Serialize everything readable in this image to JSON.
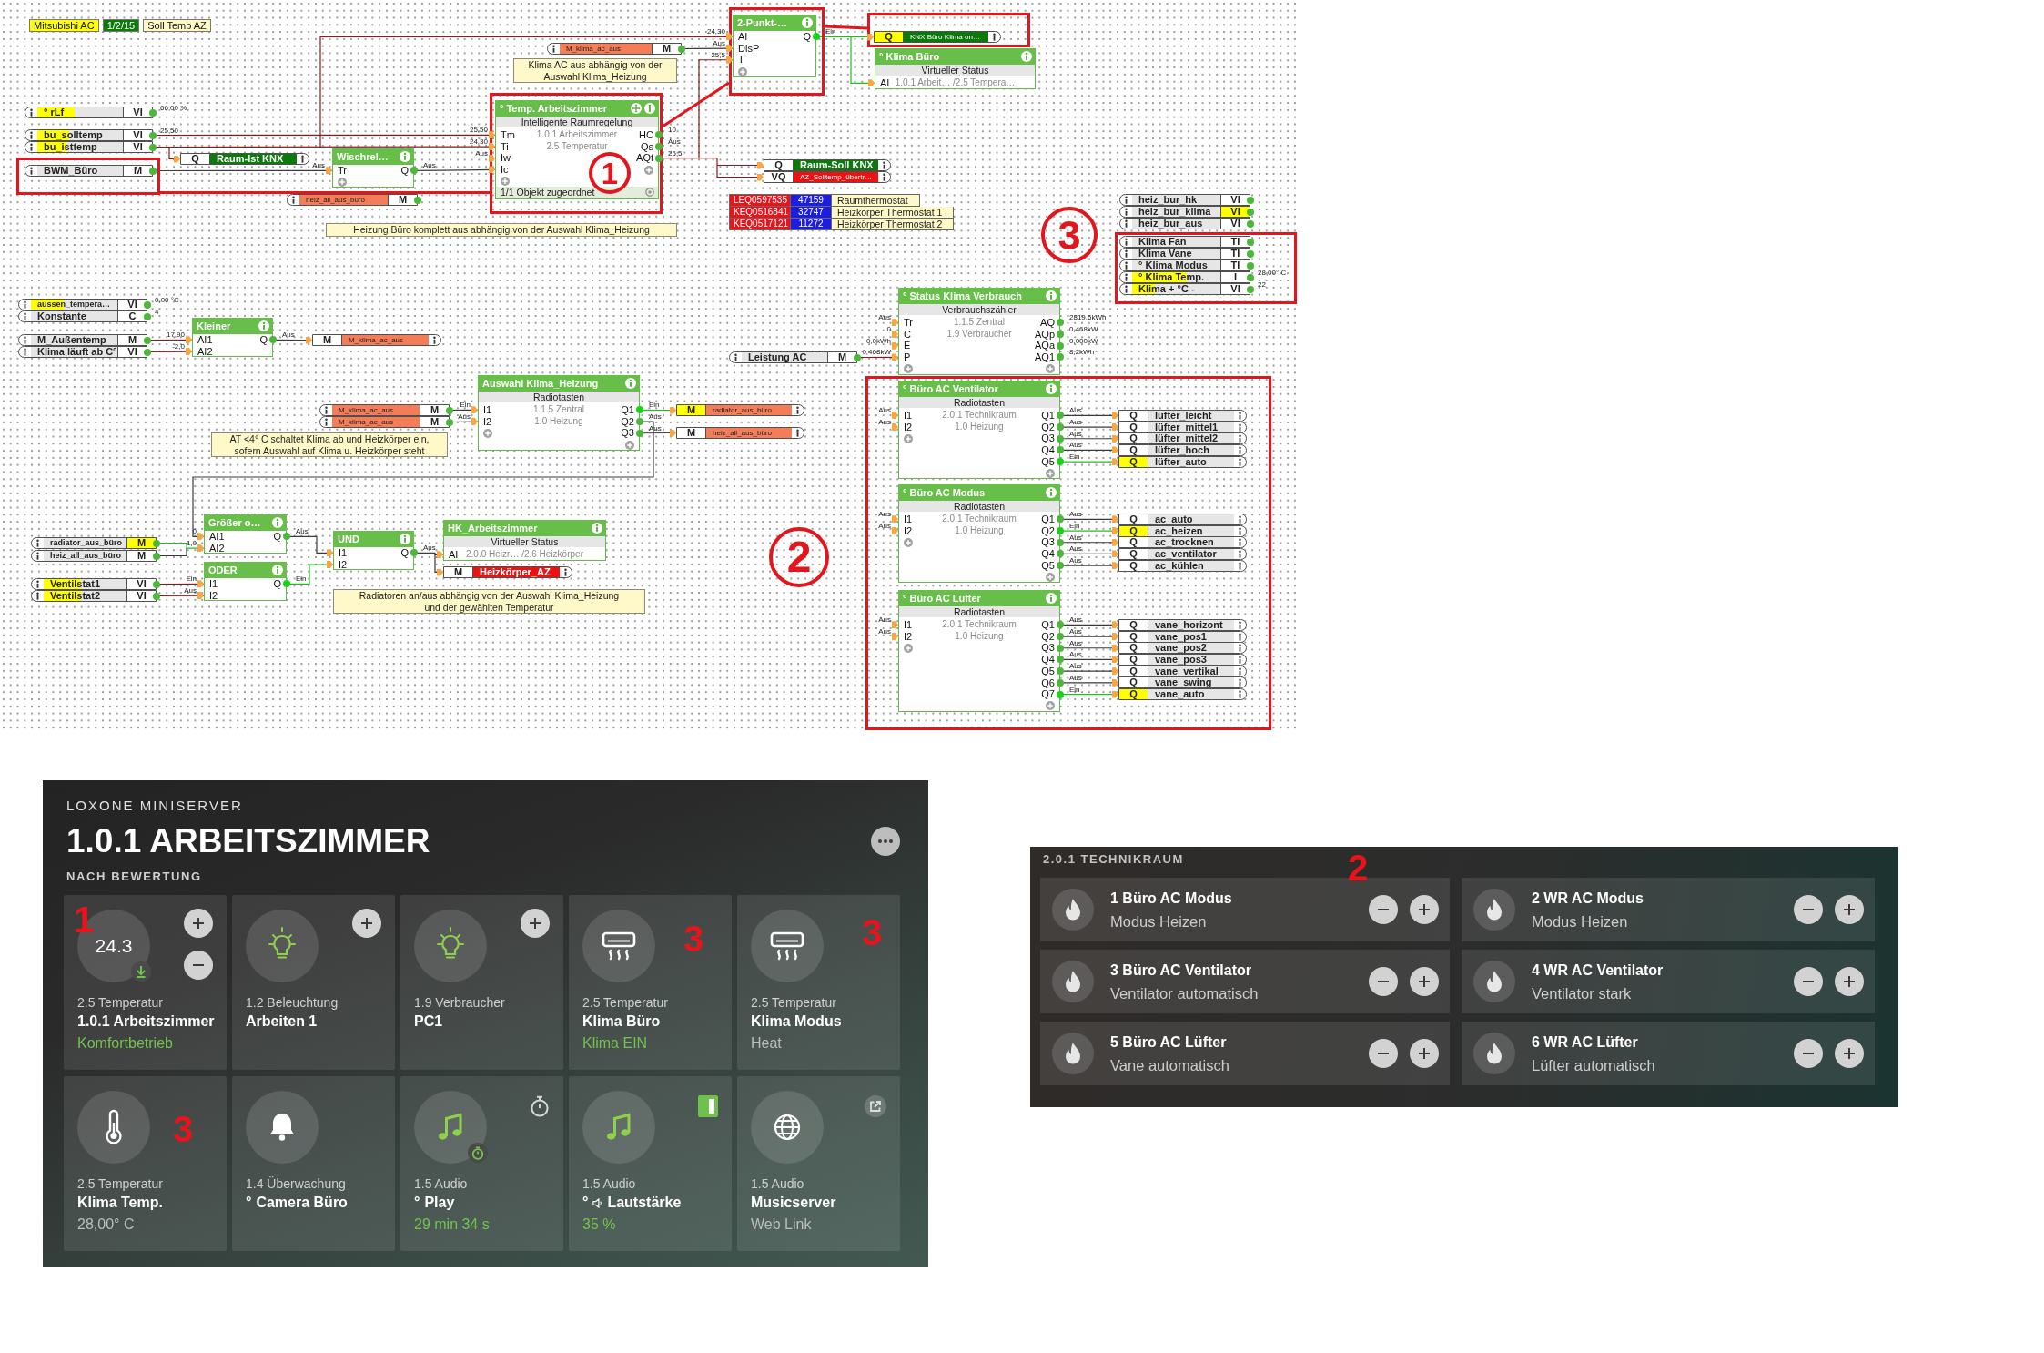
{
  "diagram": {
    "tags": [
      {
        "text": "Mitsubishi AC",
        "color": "#ffff00"
      },
      {
        "text": "1/2/15",
        "color": "#0b7a0b"
      },
      {
        "text": "Soll Temp AZ",
        "color": "#fff8c6"
      }
    ],
    "comments": [
      {
        "lines": [
          "Klima AC aus abhängig von der",
          "Auswahl Klima_Heizung"
        ]
      },
      {
        "lines": [
          "Heizung Büro komplett aus abhängig von der Auswahl Klima_Heizung"
        ]
      },
      {
        "lines": [
          "AT <4° C schaltet Klima ab und Heizkörper ein,",
          "sofern Auswahl auf Klima u. Heizkörper steht"
        ]
      },
      {
        "lines": [
          "Radiatoren an/aus abhängig von der Auswahl Klima_Heizung",
          "und der gewählten Temperatur"
        ]
      }
    ],
    "blocks": [
      {
        "kind": "logic",
        "title": "2-Punkt-…",
        "inputs": [
          {
            "label": "AI",
            "value": "24,30"
          },
          {
            "label": "DisP",
            "value": "Aus"
          },
          {
            "label": "T",
            "value": "25,5"
          }
        ],
        "outputs": [
          {
            "label": "Q",
            "value": "Ein",
            "on": true
          }
        ],
        "add_input": true,
        "add_output": false
      },
      {
        "kind": "function",
        "title": "° Klima Büro",
        "subtitle": "Virtueller Status",
        "details": [
          "1.0.1 Arbeit… /2.5 Tempera…"
        ],
        "inputs": [
          {
            "label": "AI"
          }
        ],
        "add_input": false,
        "add_output": false
      },
      {
        "kind": "logic",
        "title": "Wischrel…",
        "inputs": [
          {
            "label": "Tr",
            "value": "Aus"
          }
        ],
        "outputs": [
          {
            "label": "Q",
            "value": "Aus",
            "on": false
          }
        ],
        "add_input": true,
        "add_output": false
      },
      {
        "kind": "room_controller",
        "title": "° Temp. Arbeitszimmer",
        "subtitle": "Intelligente Raumregelung",
        "details": [
          "1.0.1 Arbeitszimmer",
          "2.5 Temperatur"
        ],
        "inputs": [
          {
            "label": "Tm",
            "value": "25,50"
          },
          {
            "label": "Ti",
            "value": "24,30"
          },
          {
            "label": "Iw",
            "value": "Aus"
          },
          {
            "label": "Ic"
          }
        ],
        "outputs": [
          {
            "label": "HC",
            "value": "10",
            "on": false
          },
          {
            "label": "Qs",
            "value": "Aus",
            "on": false
          },
          {
            "label": "AQt",
            "value": "25,5",
            "on": false
          }
        ],
        "add_input": true,
        "add_output": true,
        "footer": "1/1 Objekt zugeordnet"
      },
      {
        "kind": "logic",
        "title": "Kleiner",
        "inputs": [
          {
            "label": "AI1",
            "value": "17,90"
          },
          {
            "label": "AI2",
            "value": "-2,0"
          }
        ],
        "outputs": [
          {
            "label": "Q",
            "value": "Aus",
            "on": false
          }
        ],
        "add_input": false,
        "add_output": false
      },
      {
        "kind": "function",
        "title": "° Status Klima Verbrauch",
        "subtitle": "Verbrauchszähler",
        "details": [
          "1.1.5 Zentral",
          "1.9 Verbraucher"
        ],
        "inputs": [
          {
            "label": "Tr",
            "value": "Aus"
          },
          {
            "label": "C",
            "value": "0"
          },
          {
            "label": "E",
            "value": "0,0kWh"
          },
          {
            "label": "P",
            "value": "0,468kW"
          }
        ],
        "outputs": [
          {
            "label": "AQ",
            "value": "2819,6kWh",
            "on": false
          },
          {
            "label": "AQp",
            "value": "0,468kW",
            "on": false
          },
          {
            "label": "AQa",
            "value": "0,000kW",
            "on": false
          },
          {
            "label": "AQ1",
            "value": "8,2kWh",
            "on": false
          }
        ],
        "add_input": true,
        "add_output": true
      },
      {
        "kind": "function",
        "title": "Auswahl Klima_Heizung",
        "subtitle": "Radiotasten",
        "details": [
          "1.1.5 Zentral",
          "1.0 Heizung"
        ],
        "inputs": [
          {
            "label": "I1",
            "value": "Ein"
          },
          {
            "label": "I2",
            "value": "Aus"
          }
        ],
        "outputs": [
          {
            "label": "Q1",
            "value": "Ein",
            "on": true
          },
          {
            "label": "Q2",
            "value": "Aus",
            "on": false
          },
          {
            "label": "Q3",
            "value": "Aus",
            "on": false
          }
        ],
        "add_input": true,
        "add_output": true
      },
      {
        "kind": "function",
        "title": "° Büro AC Ventilator",
        "subtitle": "Radiotasten",
        "details": [
          "2.0.1 Technikraum",
          "1.0 Heizung"
        ],
        "inputs": [
          {
            "label": "I1",
            "value": "Aus"
          },
          {
            "label": "I2",
            "value": "Aus"
          }
        ],
        "outputs": [
          {
            "label": "Q1",
            "value": "Aus",
            "on": false
          },
          {
            "label": "Q2",
            "value": "Aus",
            "on": false
          },
          {
            "label": "Q3",
            "value": "Aus",
            "on": false
          },
          {
            "label": "Q4",
            "value": "Aus",
            "on": false
          },
          {
            "label": "Q5",
            "value": "Ein",
            "on": true
          }
        ],
        "add_input": true,
        "add_output": true
      },
      {
        "kind": "logic",
        "title": "Größer o…",
        "inputs": [
          {
            "label": "AI1",
            "value": "0"
          },
          {
            "label": "AI2",
            "value": "1,0"
          }
        ],
        "outputs": [
          {
            "label": "Q",
            "value": "Aus",
            "on": false
          }
        ],
        "add_input": false,
        "add_output": false
      },
      {
        "kind": "logic",
        "title": "ODER",
        "inputs": [
          {
            "label": "I1",
            "value": "Ein"
          },
          {
            "label": "I2",
            "value": "Aus"
          }
        ],
        "outputs": [
          {
            "label": "Q",
            "value": "Ein",
            "on": true
          }
        ],
        "add_input": false,
        "add_output": false
      },
      {
        "kind": "logic",
        "title": "UND",
        "inputs": [
          {
            "label": "I1"
          },
          {
            "label": "I2"
          }
        ],
        "outputs": [
          {
            "label": "Q",
            "value": "Aus",
            "on": false
          }
        ],
        "add_input": false,
        "add_output": false
      },
      {
        "kind": "function",
        "title": "HK_Arbeitszimmer",
        "subtitle": "Virtueller Status",
        "details": [
          "2.0.0 Heizr… /2.6 Heizkörper"
        ],
        "inputs": [
          {
            "label": "AI"
          }
        ],
        "add_input": false,
        "add_output": false
      },
      {
        "kind": "function",
        "title": "° Büro AC Modus",
        "subtitle": "Radiotasten",
        "details": [
          "2.0.1 Technikraum",
          "1.0 Heizung"
        ],
        "inputs": [
          {
            "label": "I1",
            "value": "Aus"
          },
          {
            "label": "I2",
            "value": "Aus"
          }
        ],
        "outputs": [
          {
            "label": "Q1",
            "value": "Aus",
            "on": false
          },
          {
            "label": "Q2",
            "value": "Ein",
            "on": true
          },
          {
            "label": "Q3",
            "value": "Aus",
            "on": false
          },
          {
            "label": "Q4",
            "value": "Aus",
            "on": false
          },
          {
            "label": "Q5",
            "value": "Aus",
            "on": false
          }
        ],
        "add_input": true,
        "add_output": true
      },
      {
        "kind": "function",
        "title": "° Büro AC Lüfter",
        "subtitle": "Radiotasten",
        "details": [
          "2.0.1 Technikraum",
          "1.0 Heizung"
        ],
        "inputs": [
          {
            "label": "I1",
            "value": "Aus"
          },
          {
            "label": "I2",
            "value": "Aus"
          }
        ],
        "outputs": [
          {
            "label": "Q1",
            "value": "Aus",
            "on": false
          },
          {
            "label": "Q2",
            "value": "Aus",
            "on": false
          },
          {
            "label": "Q3",
            "value": "Aus",
            "on": false
          },
          {
            "label": "Q4",
            "value": "Aus",
            "on": false
          },
          {
            "label": "Q5",
            "value": "Aus",
            "on": false
          },
          {
            "label": "Q6",
            "value": "Aus",
            "on": false
          },
          {
            "label": "Q7",
            "value": "Ein",
            "on": true
          }
        ],
        "add_input": true,
        "add_output": true
      }
    ],
    "ios": [
      {
        "kind": "input",
        "name": "° rLf",
        "type": "VI",
        "value": "66,00 %",
        "level": 0.44,
        "on": false
      },
      {
        "kind": "input",
        "name": "bu_solltemp",
        "type": "VI",
        "value": "25,50",
        "level": 0.37,
        "on": false
      },
      {
        "kind": "input",
        "name": "bu_isttemp",
        "type": "VI",
        "level": 0.34,
        "on": false
      },
      {
        "kind": "input",
        "name": "BWM_Büro",
        "type": "M",
        "on": false
      },
      {
        "kind": "output",
        "name": "Raum-Ist KNX",
        "type": "Q",
        "color": "#0b7a0b",
        "on": false
      },
      {
        "kind": "input",
        "name": "heiz_all_aus_büro",
        "type": "M",
        "color": "#f47c56",
        "on": false
      },
      {
        "kind": "input",
        "name": "M_klima_ac_aus",
        "type": "M",
        "color": "#f47c56",
        "on": false
      },
      {
        "kind": "output",
        "name": "KNX Büro Klima on…",
        "type": "Q",
        "color": "#0b7a0b",
        "on": true
      },
      {
        "kind": "output",
        "name": "Raum-Soll KNX",
        "type": "Q",
        "color": "#0b7a0b",
        "on": false
      },
      {
        "kind": "output",
        "name": "AZ_Solltemp_übertr…",
        "type": "VQ",
        "color": "#ee1111",
        "on": false
      },
      {
        "kind": "input",
        "name": "heiz_bur_hk",
        "type": "VI",
        "on": false
      },
      {
        "kind": "input",
        "name": "heiz_bur_klima",
        "type": "VI",
        "on": true
      },
      {
        "kind": "input",
        "name": "heiz_bur_aus",
        "type": "VI",
        "on": false
      },
      {
        "kind": "input",
        "name": "Klima Fan",
        "type": "TI",
        "on": false
      },
      {
        "kind": "input",
        "name": "Klima Vane",
        "type": "TI",
        "on": false
      },
      {
        "kind": "input",
        "name": "° Klima Modus",
        "type": "TI",
        "on": false
      },
      {
        "kind": "input",
        "name": "° Klima Temp.",
        "type": "I",
        "value": "28,00° C",
        "level": 0.62,
        "on": false
      },
      {
        "kind": "input",
        "name": "Klima + °C -",
        "type": "VI",
        "value": "22",
        "level": 0.26,
        "on": false
      },
      {
        "kind": "input",
        "name": "aussen_tempera…",
        "type": "VI",
        "value": "0,00 °C",
        "level": 0.38,
        "on": false
      },
      {
        "kind": "input",
        "name": "Konstante",
        "type": "C",
        "value": "4",
        "on": false
      },
      {
        "kind": "input",
        "name": "M_Außentemp",
        "type": "M",
        "on": false
      },
      {
        "kind": "input",
        "name": "Klima läuft ab C°",
        "type": "VI",
        "on": false
      },
      {
        "kind": "output",
        "name": "M_klima_ac_aus",
        "type": "M",
        "color": "#f47c56",
        "on": false
      },
      {
        "kind": "input",
        "name": "Leistung AC",
        "type": "M",
        "on": false
      },
      {
        "kind": "input",
        "name": "M_klima_ac_aus",
        "type": "M",
        "color": "#f47c56",
        "on": false
      },
      {
        "kind": "input",
        "name": "M_klima_ac_aus",
        "type": "M",
        "color": "#f47c56",
        "on": false
      },
      {
        "kind": "output",
        "name": "radiator_aus_büro",
        "type": "M",
        "color": "#f47c56",
        "on": true
      },
      {
        "kind": "output",
        "name": "heiz_all_aus_büro",
        "type": "M",
        "color": "#f47c56",
        "on": false
      },
      {
        "kind": "input",
        "name": "radiator_aus_büro",
        "type": "M",
        "on": true
      },
      {
        "kind": "input",
        "name": "heiz_all_aus_büro",
        "type": "M",
        "on": false
      },
      {
        "kind": "input",
        "name": "Ventilstat1",
        "type": "VI",
        "level": 0.45,
        "on": false
      },
      {
        "kind": "input",
        "name": "Ventilstat2",
        "type": "VI",
        "level": 0.45,
        "on": false
      },
      {
        "kind": "output",
        "name": "Heizkörper_AZ",
        "type": "M",
        "color": "#ee1111",
        "on": false
      },
      {
        "kind": "output",
        "name": "lüfter_leicht",
        "type": "Q",
        "on": false
      },
      {
        "kind": "output",
        "name": "lüfter_mittel1",
        "type": "Q",
        "on": false
      },
      {
        "kind": "output",
        "name": "lüfter_mittel2",
        "type": "Q",
        "on": false
      },
      {
        "kind": "output",
        "name": "lüfter_hoch",
        "type": "Q",
        "on": false
      },
      {
        "kind": "output",
        "name": "lüfter_auto",
        "type": "Q",
        "on": true
      },
      {
        "kind": "output",
        "name": "ac_auto",
        "type": "Q",
        "on": false
      },
      {
        "kind": "output",
        "name": "ac_heizen",
        "type": "Q",
        "on": true
      },
      {
        "kind": "output",
        "name": "ac_trocknen",
        "type": "Q",
        "on": false
      },
      {
        "kind": "output",
        "name": "ac_ventilator",
        "type": "Q",
        "on": false
      },
      {
        "kind": "output",
        "name": "ac_kühlen",
        "type": "Q",
        "on": false
      },
      {
        "kind": "output",
        "name": "vane_horizont",
        "type": "Q",
        "on": false
      },
      {
        "kind": "output",
        "name": "vane_pos1",
        "type": "Q",
        "on": false
      },
      {
        "kind": "output",
        "name": "vane_pos2",
        "type": "Q",
        "on": false
      },
      {
        "kind": "output",
        "name": "vane_pos3",
        "type": "Q",
        "on": false
      },
      {
        "kind": "output",
        "name": "vane_vertikal",
        "type": "Q",
        "on": false
      },
      {
        "kind": "output",
        "name": "vane_swing",
        "type": "Q",
        "on": false
      },
      {
        "kind": "output",
        "name": "vane_auto",
        "type": "Q",
        "on": true
      }
    ],
    "devices": [
      {
        "serial": "LEQ0597535",
        "code": "47159",
        "name": "Raumthermostat"
      },
      {
        "serial": "KEQ0516841",
        "code": "32747",
        "name": "Heizkörper Thermostat 1"
      },
      {
        "serial": "KEQ0517121",
        "code": "11272",
        "name": "Heizkörper Thermostat 2"
      }
    ],
    "callouts": [
      "1",
      "2",
      "3"
    ]
  },
  "app_panel": {
    "header": "LOXONE MINISERVER",
    "title": "1.0.1 ARBEITSZIMMER",
    "section": "NACH BEWERTUNG",
    "tiles": [
      {
        "kind": "climate",
        "reading": "24.3",
        "badge": {
          "kind": "arrow"
        },
        "buttons": [
          {
            "kind": "plus"
          },
          {
            "kind": "minus"
          }
        ],
        "annotation": "1",
        "category": "2.5 Temperatur",
        "name": "1.0.1 Arbeitszimmer",
        "status": "Komfortbetrieb",
        "color": "#72c34e",
        "on": false
      },
      {
        "kind": "light",
        "buttons": [
          {
            "kind": "plus"
          }
        ],
        "category": "1.2 Beleuchtung",
        "name": "Arbeiten 1",
        "on": true
      },
      {
        "kind": "light",
        "buttons": [
          {
            "kind": "plus"
          }
        ],
        "category": "1.9 Verbraucher",
        "name": "PC1",
        "on": true
      },
      {
        "kind": "air_conditioner",
        "annotation": "3",
        "category": "2.5 Temperatur",
        "name": "Klima Büro",
        "status": "Klima EIN",
        "color": "#72c34e",
        "on": false
      },
      {
        "kind": "air_conditioner",
        "annotation": "3",
        "category": "2.5 Temperatur",
        "name": "Klima Modus",
        "status": "Heat",
        "color": "#bdbdbd",
        "on": false
      },
      {
        "kind": "thermometer",
        "annotation": "3",
        "category": "2.5 Temperatur",
        "name": "Klima Temp.",
        "status": "28,00° C",
        "color": "#bdbdbd",
        "on": false
      },
      {
        "kind": "bell",
        "category": "1.4 Überwachung",
        "marker": "°",
        "name": "Camera Büro",
        "on": false
      },
      {
        "kind": "music",
        "badge": {
          "kind": "stopwatch"
        },
        "corner_icon": {
          "kind": "stopwatch"
        },
        "category": "1.5 Audio",
        "marker": "°",
        "name": "Play",
        "status": "29 min 34 s",
        "color": "#72c34e",
        "on": true
      },
      {
        "kind": "music",
        "corner_icon": {
          "kind": "panel"
        },
        "category": "1.5 Audio",
        "marker": "°",
        "name_icon": {
          "kind": "speaker"
        },
        "name": "Lautstärke",
        "status": "35 %",
        "color": "#72c34e",
        "on": true
      },
      {
        "kind": "web",
        "corner_icon": {
          "kind": "external_link"
        },
        "category": "1.5 Audio",
        "name": "Musicserver",
        "status": "Web Link",
        "color": "#bdbdbd",
        "on": false
      }
    ]
  },
  "room_panel": {
    "title": "2.0.1 TECHNIKRAUM",
    "annotation": "2",
    "controls": [
      {
        "name": "1 Büro AC Modus",
        "state": "Modus Heizen"
      },
      {
        "name": "2 WR AC Modus",
        "state": "Modus Heizen"
      },
      {
        "name": "3 Büro AC Ventilator",
        "state": "Ventilator automatisch"
      },
      {
        "name": "4 WR AC Ventilator",
        "state": "Ventilator stark"
      },
      {
        "name": "5 Büro AC Lüfter",
        "state": "Vane automatisch"
      },
      {
        "name": "6 WR AC Lüfter",
        "state": "Lüfter automatisch"
      }
    ]
  }
}
